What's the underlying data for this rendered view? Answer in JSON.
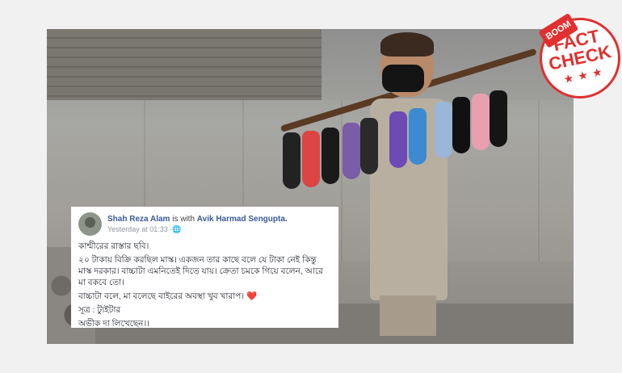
{
  "badge": {
    "brand": "BOOM",
    "line1": "FACT",
    "line2": "CHECK",
    "stars": "★ ★ ★"
  },
  "post": {
    "author": "Shah Reza Alam",
    "with_word": "is with",
    "with_name": "Avik Harmad Sengupta.",
    "time": "Yesterday at 01:33",
    "globe_icon": "globe-icon",
    "paragraphs": [
      "কাশ্মীরের রাস্তার ছবি।",
      "২০ টাকায় বিক্রি করছিল মাস্ক। একজন তার কাছে বলে যে টাকা নেই কিন্তু মাস্ক দরকার। বাচ্চাটা এমনিতেই দিতে যায়। ক্রেতা চমকে গিয়ে বলেন, আরে মা বকবে তো।",
      "বাচ্চাটা বলে, মা বলেছে বাইরের অবস্থা খুব খারাপ। ❤️",
      "সূত্র : ট্যুইটার",
      "অভীক দা লিখেছেন।।"
    ]
  },
  "colors": {
    "brand_red": "#e03030",
    "link_blue": "#385898"
  }
}
